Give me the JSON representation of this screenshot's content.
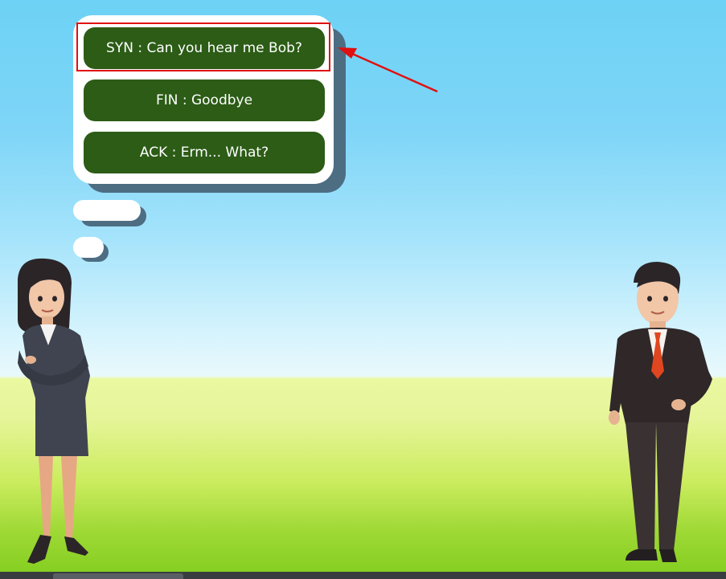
{
  "dialogue": {
    "options": [
      {
        "label": "SYN : Can you hear me Bob?"
      },
      {
        "label": "FIN : Goodbye"
      },
      {
        "label": "ACK : Erm... What?"
      }
    ]
  },
  "annotation": {
    "highlighted_option": 0,
    "color": "#e01010"
  },
  "colors": {
    "option_bg": "#2c5c16",
    "bubble_bg": "#ffffff",
    "bubble_shadow": "#4d6d83",
    "sky": "#6dd2f5",
    "grass": "#86cf22"
  },
  "characters": [
    {
      "name": "woman-character"
    },
    {
      "name": "man-character"
    }
  ]
}
